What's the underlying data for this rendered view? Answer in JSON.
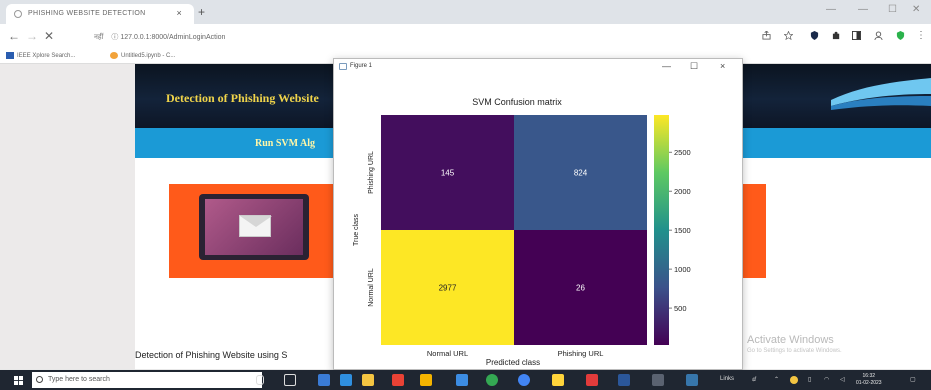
{
  "browser": {
    "tab_title": "PHISHING WEBSITE DETECTION",
    "tab_close": "×",
    "new_tab": "+",
    "url_chip": "नहीं",
    "url": "127.0.0.1:8000/AdminLoginAction",
    "bookmarks": [
      {
        "label": "IEEE Xplore Search...",
        "icon": "ieee-icon",
        "color": "#2a5db0"
      },
      {
        "label": "Untitled5.ipynb - C...",
        "icon": "colab-icon",
        "color": "#f2a33a"
      }
    ]
  },
  "page": {
    "banner_title": "Detection of Phishing Website",
    "run_button": "Run SVM Alg",
    "bottom_text": "Detection of Phishing Website using S",
    "activate_title": "Activate Windows",
    "activate_sub": "Go to Settings to activate Windows."
  },
  "figure": {
    "window_title": "Figure 1",
    "minimize": "—",
    "maximize": "☐",
    "close": "×"
  },
  "chart_data": {
    "type": "heatmap",
    "title": "SVM Confusion matrix",
    "xlabel": "Predicted class",
    "ylabel": "True class",
    "x_categories": [
      "Normal URL",
      "Phishing URL"
    ],
    "y_categories": [
      "Phishing URL",
      "Normal URL"
    ],
    "cells": [
      {
        "row": 0,
        "col": 0,
        "value": 145
      },
      {
        "row": 0,
        "col": 1,
        "value": 824
      },
      {
        "row": 1,
        "col": 0,
        "value": 2977
      },
      {
        "row": 1,
        "col": 1,
        "value": 26
      }
    ],
    "colorbar": {
      "min": 26,
      "max": 2977,
      "ticks": [
        500,
        1000,
        1500,
        2000,
        2500
      ],
      "colormap": "viridis"
    }
  },
  "taskbar": {
    "search_placeholder": "Type here to search",
    "tray_text": "Links",
    "time": "16:32",
    "date": "01-02-2023"
  }
}
